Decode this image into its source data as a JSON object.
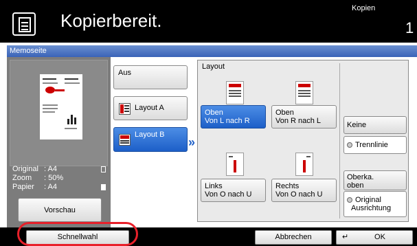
{
  "header": {
    "title": "Kopierbereit.",
    "mode": "Kopien",
    "count": "1"
  },
  "memo_header": "Memoseite",
  "left": {
    "original_label": "Original",
    "original_value": ": A4",
    "zoom_label": "Zoom",
    "zoom_value": ": 50%",
    "paper_label": "Papier",
    "paper_value": ": A4",
    "preview_button": "Vorschau"
  },
  "options": {
    "aus": "Aus",
    "layout_a": "Layout A",
    "layout_b": "Layout B"
  },
  "layout": {
    "title": "Layout",
    "oben_lr_1": "Oben",
    "oben_lr_2": "Von L nach R",
    "oben_rl_1": "Oben",
    "oben_rl_2": "Von R nach L",
    "links_1": "Links",
    "links_2": "Von O nach U",
    "rechts_1": "Rechts",
    "rechts_2": "Von O nach U"
  },
  "border": {
    "keine": "Keine",
    "trennlinie": "Trennlinie"
  },
  "orientation": {
    "line1": "Oberka.",
    "line2": "oben",
    "original": "Original",
    "ausrichtung": "Ausrichtung"
  },
  "bottom": {
    "schnellwahl": "Schnellwahl",
    "abbrechen": "Abbrechen",
    "ok": "OK"
  },
  "colors": {
    "selected_blue": "#1d5fc8",
    "highlight_red": "#e8202a"
  }
}
